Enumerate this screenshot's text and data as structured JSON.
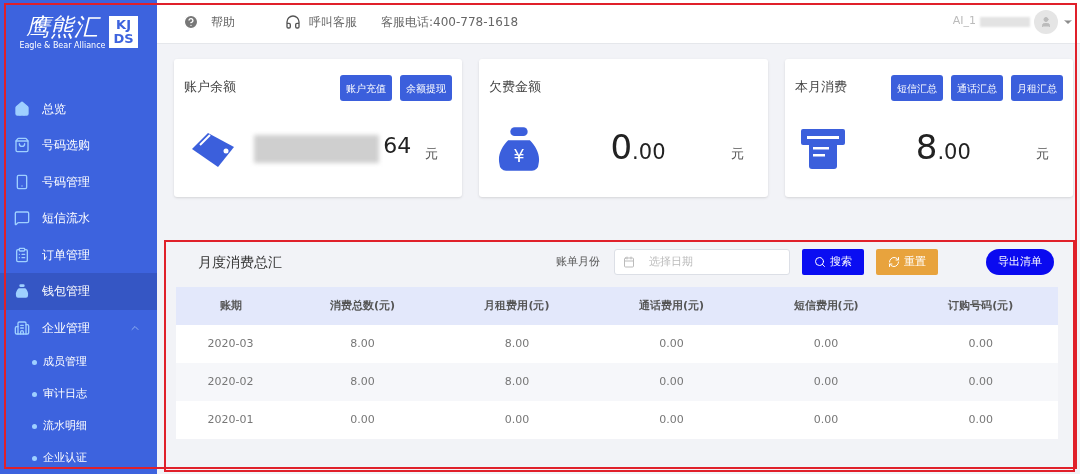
{
  "logo": {
    "brand": "鹰熊汇",
    "tagline": "Eagle & Bear Alliance",
    "badge_top": "KJ",
    "badge_bottom": "DS"
  },
  "header": {
    "help": "帮助",
    "call_service": "呼叫客服",
    "hotline": "客服电话:400-778-1618",
    "user": "AI_1"
  },
  "sidebar": {
    "items": [
      {
        "label": "总览",
        "kind": "home",
        "selected": false
      },
      {
        "label": "号码选购",
        "kind": "bag",
        "selected": false
      },
      {
        "label": "号码管理",
        "kind": "phone",
        "selected": false
      },
      {
        "label": "短信流水",
        "kind": "message",
        "selected": false
      },
      {
        "label": "订单管理",
        "kind": "clipboard",
        "selected": false
      },
      {
        "label": "钱包管理",
        "kind": "moneybag",
        "selected": true
      },
      {
        "label": "企业管理",
        "kind": "building",
        "selected": false,
        "expanded": true,
        "children": [
          {
            "label": "成员管理",
            "selected": false
          },
          {
            "label": "审计日志",
            "selected": false
          },
          {
            "label": "流水明细",
            "selected": false
          },
          {
            "label": "企业认证",
            "selected": false
          }
        ]
      }
    ]
  },
  "cards": [
    {
      "title": "账户余额",
      "kind": "wallet",
      "masked": true,
      "amount": "64",
      "unit": "元",
      "buttons": [
        "账户充值",
        "余额提现"
      ]
    },
    {
      "title": "欠费金额",
      "kind": "moneybag",
      "icon_text": "¥",
      "amount": "0",
      "decimals": ".00",
      "unit": "元"
    },
    {
      "title": "本月消费",
      "kind": "receipt",
      "amount": "8",
      "decimals": ".00",
      "unit": "元",
      "buttons": [
        "短信汇总",
        "通话汇总",
        "月租汇总"
      ]
    }
  ],
  "summary": {
    "title": "月度消费总汇",
    "filter_label": "账单月份",
    "date_placeholder": "选择日期",
    "search": "搜索",
    "reset": "重置",
    "export": "导出清单",
    "table": {
      "columns": [
        "账期",
        "消费总数(元)",
        "月租费用(元)",
        "通话费用(元)",
        "短信费用(元)",
        "订购号码(元)"
      ],
      "rows": [
        [
          "2020-03",
          "8.00",
          "8.00",
          "0.00",
          "0.00",
          "0.00"
        ],
        [
          "2020-02",
          "8.00",
          "8.00",
          "0.00",
          "0.00",
          "0.00"
        ],
        [
          "2020-01",
          "0.00",
          "0.00",
          "0.00",
          "0.00",
          "0.00"
        ]
      ]
    }
  }
}
